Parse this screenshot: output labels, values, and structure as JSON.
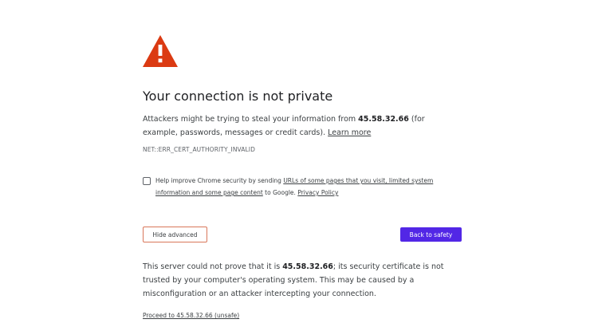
{
  "icon": {
    "name": "warning-triangle-icon",
    "color": "#db3a12"
  },
  "title": "Your connection is not private",
  "intro": {
    "text_before": "Attackers might be trying to steal your information from ",
    "host": "45.58.32.66",
    "text_after": " (for example, passwords, messages or credit cards). ",
    "learn_more": "Learn more"
  },
  "error_code": "NET::ERR_CERT_AUTHORITY_INVALID",
  "opt_in": {
    "text_before": "Help improve Chrome security by sending ",
    "link1": "URLs of some pages that you visit, limited system information and some page content",
    "text_middle": " to Google. ",
    "privacy_link": "Privacy Policy",
    "checked": false
  },
  "buttons": {
    "advanced": "Hide advanced",
    "back": "Back to safety",
    "accent_color": "#5227e6"
  },
  "details": {
    "text_before": "This server could not prove that it is ",
    "host": "45.58.32.66",
    "text_after": "; its security certificate is not trusted by your computer's operating system. This may be caused by a misconfiguration or an attacker intercepting your connection."
  },
  "proceed_link": "Proceed to 45.58.32.66 (unsafe)"
}
